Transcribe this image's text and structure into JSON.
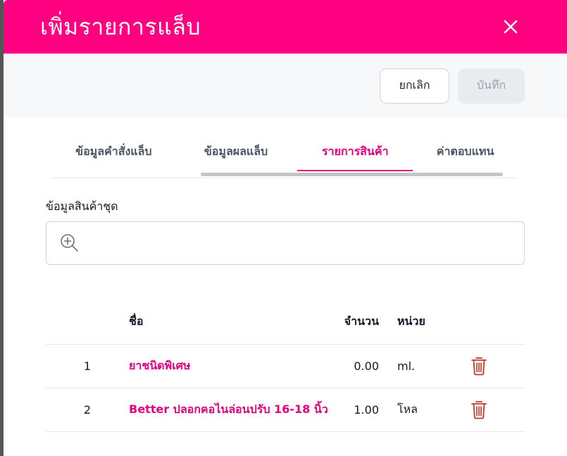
{
  "header": {
    "title": "เพิ่มรายการแล็บ"
  },
  "toolbar": {
    "cancel_label": "ยกเลิก",
    "save_label": "บันทึก"
  },
  "tabs": [
    {
      "label": "ข้อมูลคำสั่งแล็บ",
      "active": false
    },
    {
      "label": "ข้อมูลผลแล็บ",
      "active": false
    },
    {
      "label": "รายการสินค้า",
      "active": true
    },
    {
      "label": "ค่าตอบแทน",
      "active": false
    }
  ],
  "bundle": {
    "label": "ข้อมูลสินค้าชุด",
    "placeholder": ""
  },
  "table": {
    "headers": {
      "name": "ชื่อ",
      "qty": "จำนวน",
      "unit": "หน่วย"
    },
    "rows": [
      {
        "index": "1",
        "name": "ยาชนิดพิเศษ",
        "qty": "0.00",
        "unit": "ml."
      },
      {
        "index": "2",
        "name": "Better ปลอกคอไนล่อนปรับ 16-18 นิ้ว",
        "qty": "1.00",
        "unit": "โหล"
      }
    ]
  },
  "colors": {
    "brand": "#ff0080",
    "accent_text": "#e6007e",
    "delete": "#c0392b"
  }
}
